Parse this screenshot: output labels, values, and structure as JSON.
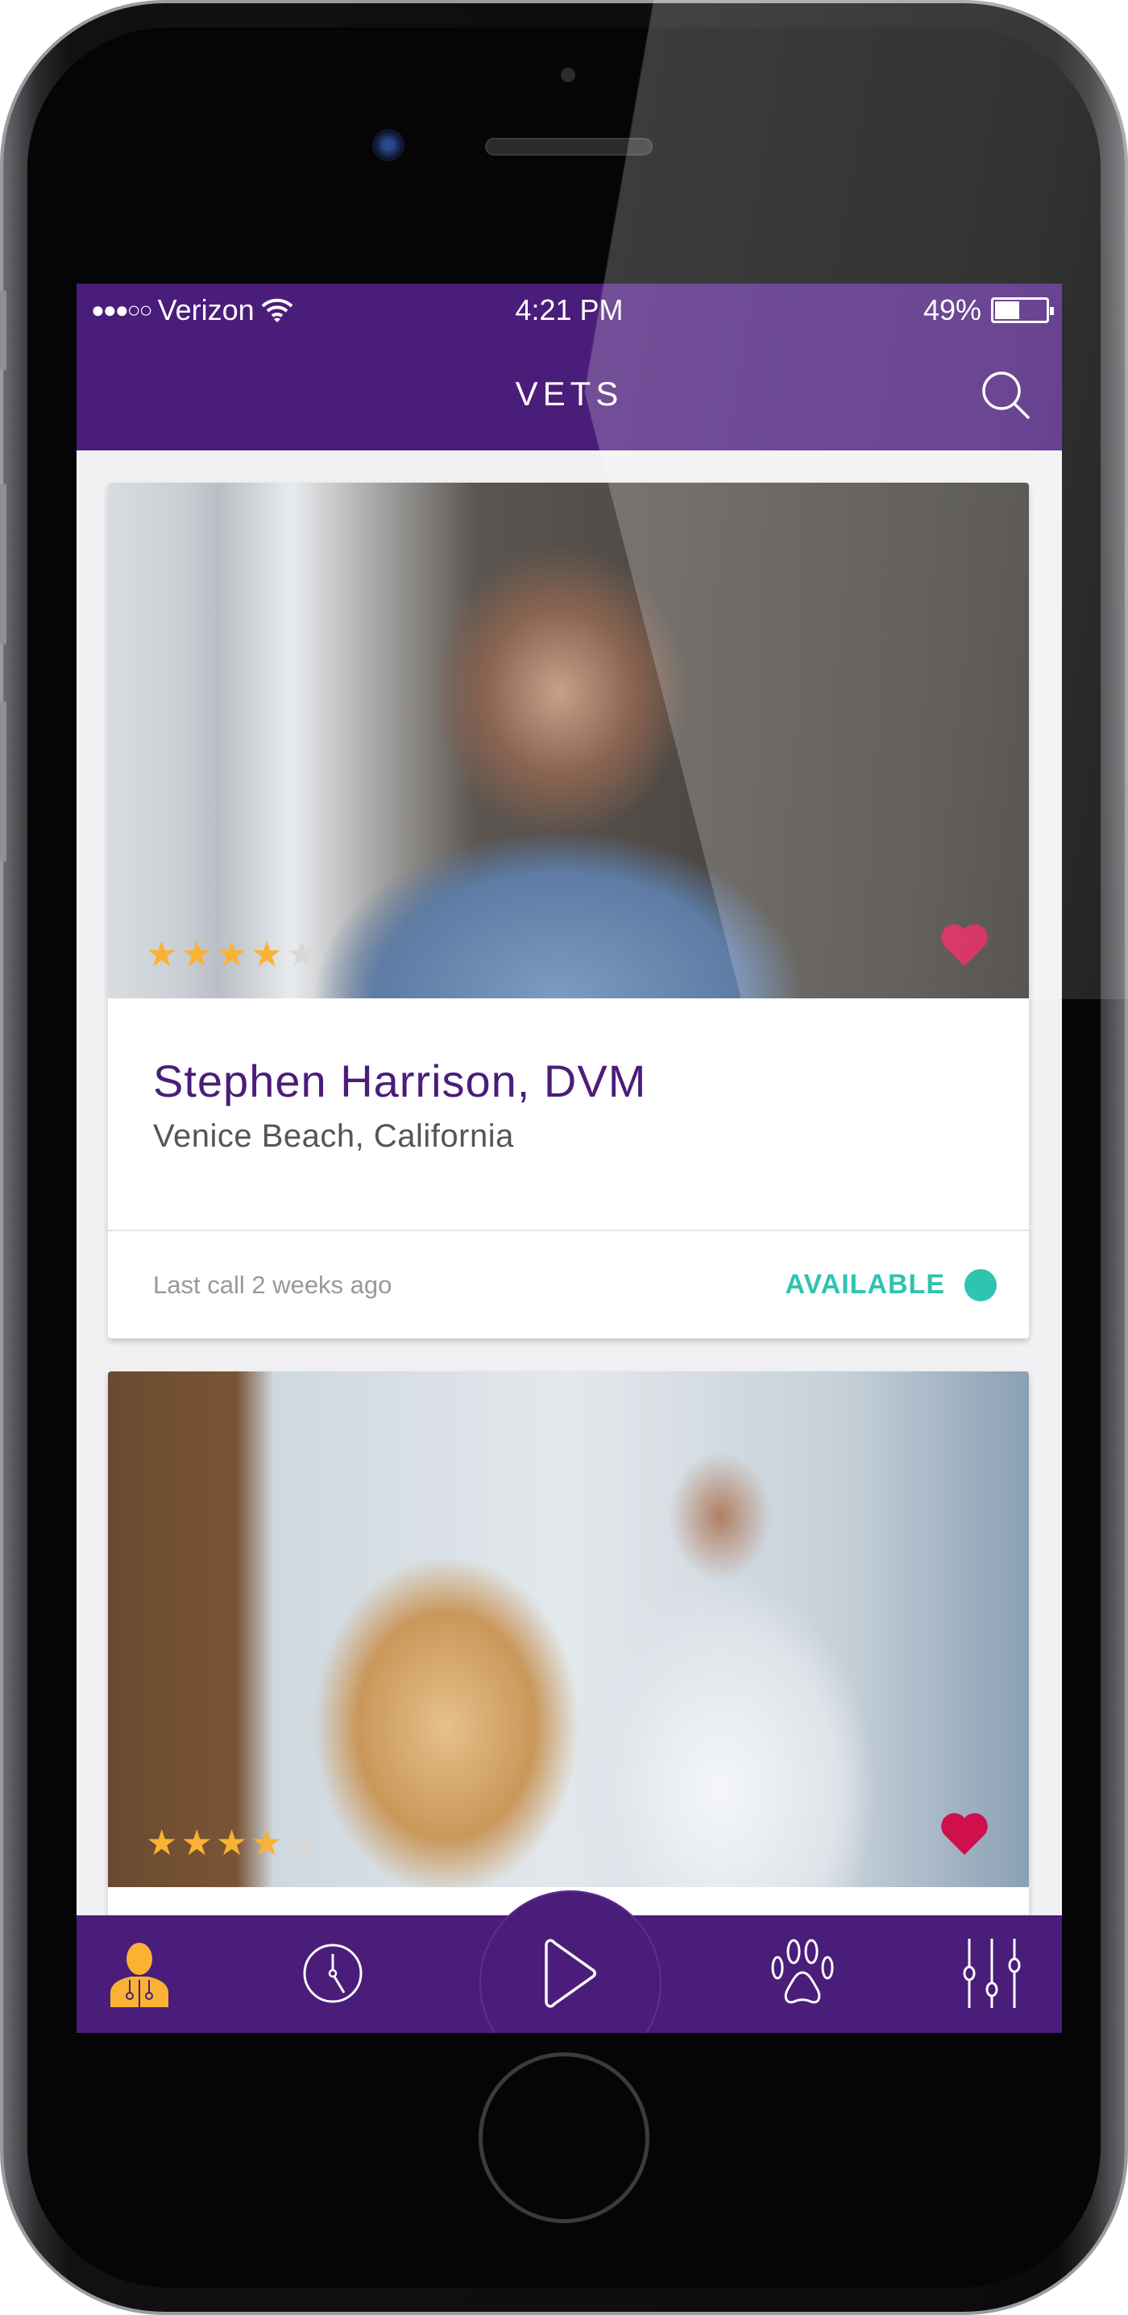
{
  "status_bar": {
    "carrier": "Verizon",
    "signal_dots": "●●●○○",
    "time": "4:21 PM",
    "battery": "49%",
    "battery_level": 0.49
  },
  "header": {
    "title": "VETS",
    "search_icon": "search-icon"
  },
  "colors": {
    "brand": "#4a1d7a",
    "accent": "#f9b233",
    "available": "#2ec4b0",
    "favorite": "#d0104c"
  },
  "vets": [
    {
      "name": "Stephen Harrison, DVM",
      "location": "Venice Beach, California",
      "last_call": "Last call 2 weeks ago",
      "status": "AVAILABLE",
      "rating": 4,
      "rating_max": 5,
      "favorite": true
    },
    {
      "rating": 4,
      "rating_max": 5,
      "favorite": true
    }
  ],
  "tab_bar": {
    "items": [
      {
        "icon": "vet-doctor-icon",
        "active": true
      },
      {
        "icon": "clock-icon",
        "active": false
      },
      {
        "icon": "play-icon",
        "active": false
      },
      {
        "icon": "paw-icon",
        "active": false
      },
      {
        "icon": "sliders-icon",
        "active": false
      }
    ]
  }
}
